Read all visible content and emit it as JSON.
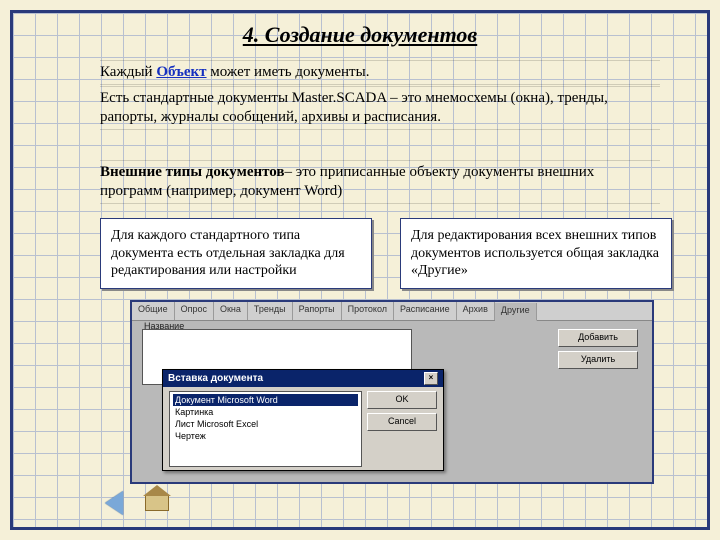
{
  "title": "4. Создание документов",
  "p1_pre": "Каждый ",
  "p1_link": "Объект",
  "p1_post": " может иметь документы.",
  "p2": "Есть стандартные документы Master.SCADA – это мнемосхемы (окна), тренды, рапорты, журналы сообщений, архивы и расписания.",
  "p3_bold": "Внешние типы документов",
  "p3_rest": "– это приписанные объекту документы внешних программ (например, документ Word)",
  "box_left": "Для каждого стандартного типа документа есть отдельная закладка для редактирования или настройки",
  "box_right": "Для редактирования всех внешних типов документов используется общая закладка «Другие»",
  "app": {
    "tabs": [
      "Общие",
      "Опрос",
      "Окна",
      "Тренды",
      "Рапорты",
      "Протокол",
      "Расписание",
      "Архив",
      "Другие"
    ],
    "panel_label": "Название",
    "buttons": {
      "add": "Добавить",
      "del": "Удалить"
    },
    "dialog": {
      "title": "Вставка документа",
      "items": [
        "Документ Microsoft Word",
        "Картинка",
        "Лист Microsoft Excel",
        "Чертеж"
      ],
      "ok": "OK",
      "cancel": "Cancel",
      "close": "×"
    }
  }
}
